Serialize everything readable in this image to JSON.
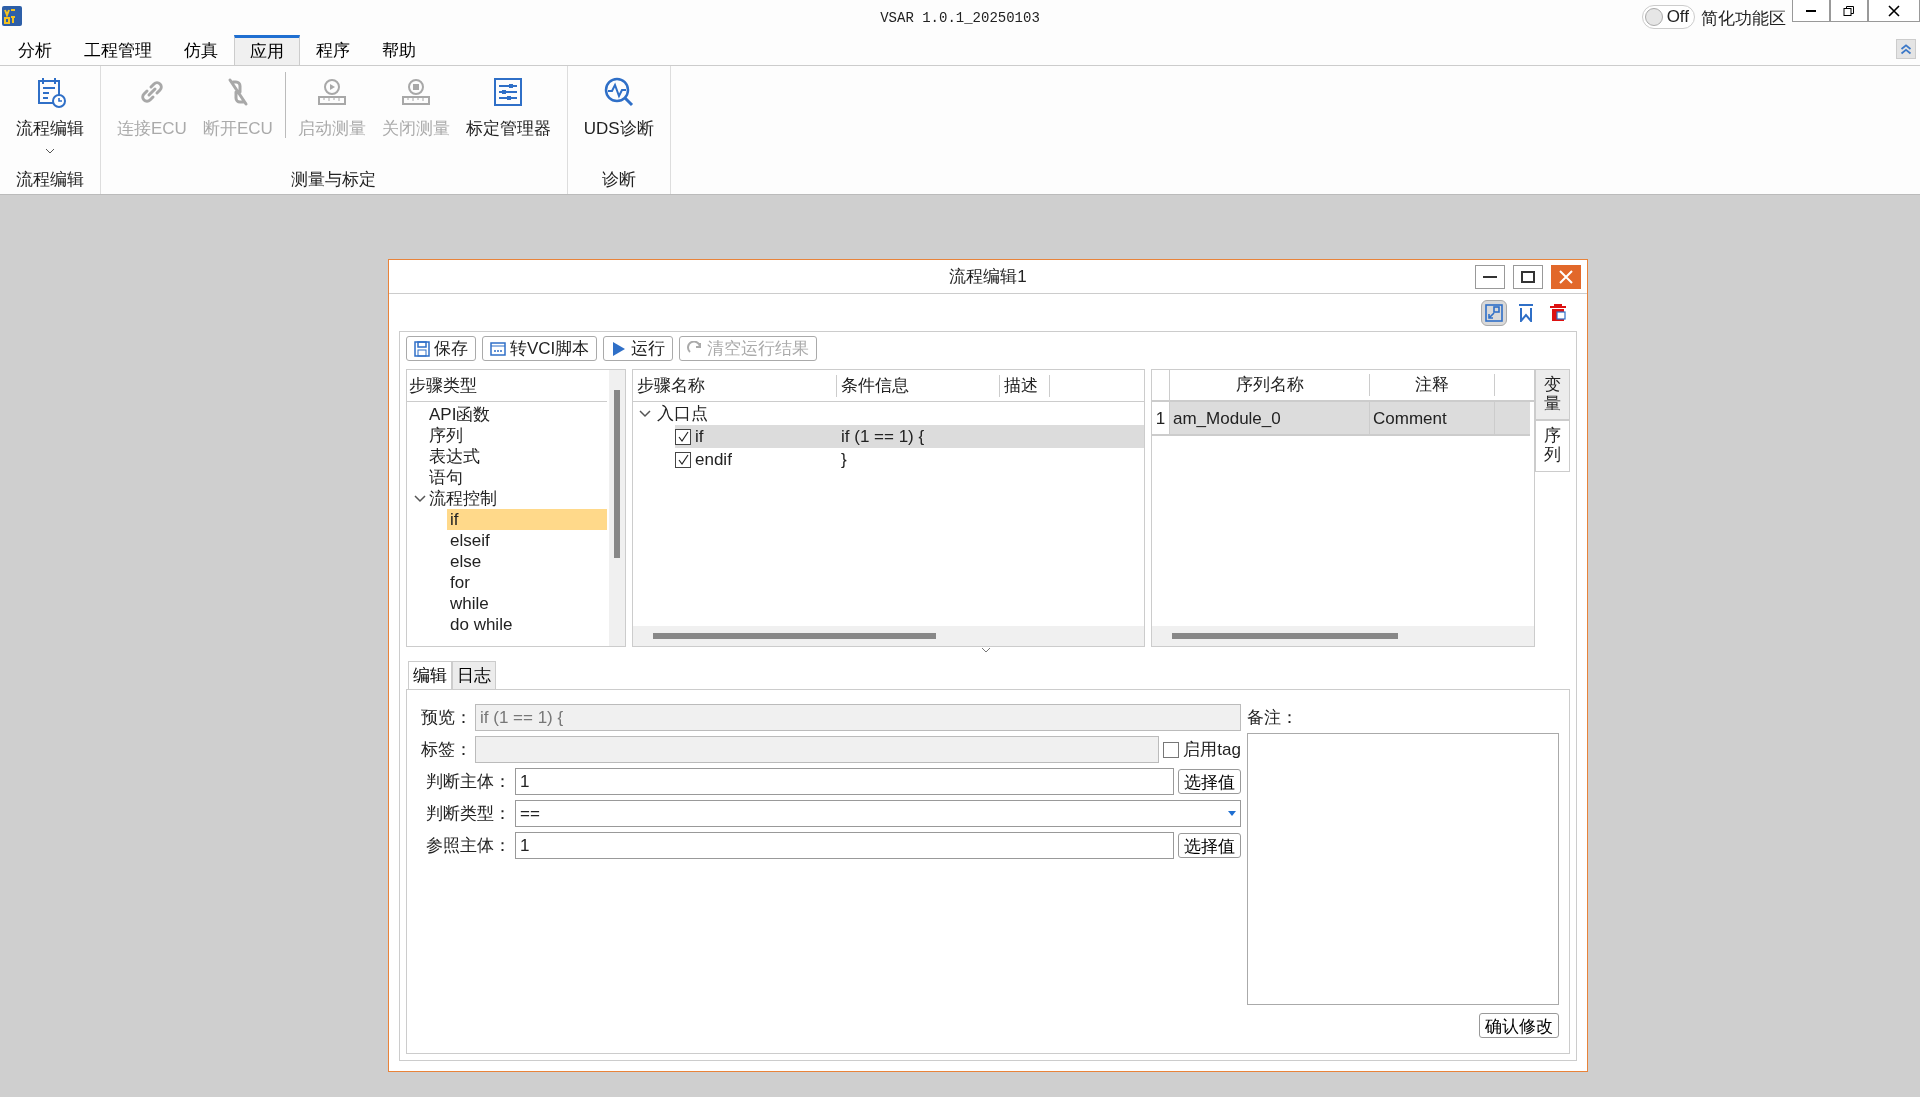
{
  "app": {
    "title": "VSAR 1.0.1_20250103",
    "toggle": {
      "on": false,
      "label": "Off"
    },
    "toggle_caption": "简化功能区"
  },
  "menu_tabs": [
    {
      "label": "分析",
      "selected": false
    },
    {
      "label": "工程管理",
      "selected": false
    },
    {
      "label": "仿真",
      "selected": false
    },
    {
      "label": "应用",
      "selected": true
    },
    {
      "label": "程序",
      "selected": false
    },
    {
      "label": "帮助",
      "selected": false
    }
  ],
  "ribbon_groups": [
    {
      "label": "流程编辑",
      "items": [
        {
          "label": "流程编辑",
          "disabled": false,
          "dropdown": true
        }
      ]
    },
    {
      "label": "测量与标定",
      "items": [
        {
          "label": "连接ECU",
          "disabled": true,
          "dropdown": false
        },
        {
          "label": "断开ECU",
          "disabled": true,
          "dropdown": false
        },
        {
          "label": "启动测量",
          "disabled": true,
          "dropdown": false
        },
        {
          "label": "关闭测量",
          "disabled": true,
          "dropdown": false
        },
        {
          "label": "标定管理器",
          "disabled": false,
          "dropdown": false
        }
      ]
    },
    {
      "label": "诊断",
      "items": [
        {
          "label": "UDS诊断",
          "disabled": false,
          "dropdown": false
        }
      ]
    }
  ],
  "dialog": {
    "title": "流程编辑1",
    "buttons": [
      {
        "label": "保存",
        "disabled": false
      },
      {
        "label": "转VCI脚本",
        "disabled": false
      },
      {
        "label": "运行",
        "disabled": false
      },
      {
        "label": "清空运行结果",
        "disabled": true
      }
    ],
    "step_types": {
      "header": "步骤类型",
      "items": [
        {
          "label": "API函数",
          "selected": false
        },
        {
          "label": "序列",
          "selected": false
        },
        {
          "label": "表达式",
          "selected": false
        },
        {
          "label": "语句",
          "selected": false
        },
        {
          "label": "流程控制",
          "selected": false,
          "expanded": true,
          "children": [
            {
              "label": "if",
              "selected": true
            },
            {
              "label": "elseif",
              "selected": false
            },
            {
              "label": "else",
              "selected": false
            },
            {
              "label": "for",
              "selected": false
            },
            {
              "label": "while",
              "selected": false
            },
            {
              "label": "do while",
              "selected": false
            }
          ]
        }
      ]
    },
    "steps": {
      "columns": [
        "步骤名称",
        "条件信息",
        "描述"
      ],
      "root": {
        "label": "入口点",
        "expanded": true,
        "children": [
          {
            "name": "if",
            "condition": "if (1 == 1) {",
            "checked": true,
            "selected": true
          },
          {
            "name": "endif",
            "condition": "}",
            "checked": true,
            "selected": false
          }
        ]
      }
    },
    "sequences": {
      "columns": [
        "序列名称",
        "注释"
      ],
      "rows": [
        {
          "index": "1",
          "name": "am_Module_0",
          "comment": "Comment",
          "selected": true
        }
      ]
    },
    "side_tabs": [
      {
        "label": "变量",
        "selected": false
      },
      {
        "label": "序列",
        "selected": true
      }
    ],
    "bottom_tabs": [
      {
        "label": "编辑",
        "selected": true
      },
      {
        "label": "日志",
        "selected": false
      }
    ],
    "form": {
      "preview": {
        "label": "预览：",
        "value": "if (1 == 1) {"
      },
      "tag": {
        "label": "标签："
      },
      "enable_tag": {
        "label": "启用tag",
        "checked": false
      },
      "fields": [
        {
          "kind": "input",
          "label": "判断主体：",
          "value": "1",
          "button": "选择值"
        },
        {
          "kind": "select",
          "label": "判断类型：",
          "value": "=="
        },
        {
          "kind": "input",
          "label": "参照主体：",
          "value": "1",
          "button": "选择值"
        }
      ],
      "note_label": "备注：",
      "confirm": "确认修改"
    }
  }
}
